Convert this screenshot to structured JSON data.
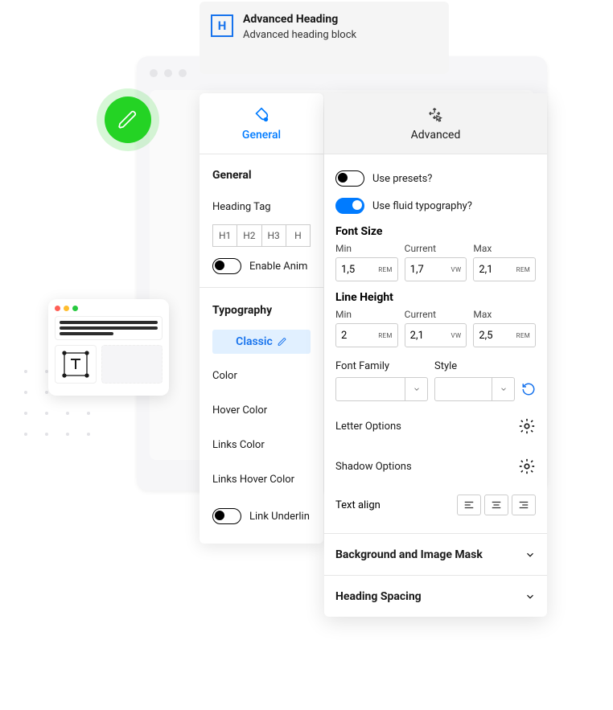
{
  "header": {
    "icon_letter": "H",
    "title": "Advanced Heading",
    "subtitle": "Advanced heading block"
  },
  "tabs": {
    "general": "General",
    "advanced": "Advanced"
  },
  "general": {
    "section": "General",
    "heading_tag_label": "Heading Tag",
    "tags": [
      "H1",
      "H2",
      "H3",
      "H"
    ],
    "enable_anim": "Enable Anim",
    "typography_section": "Typography",
    "classic": "Classic",
    "color": "Color",
    "hover_color": "Hover Color",
    "links_color": "Links Color",
    "links_hover_color": "Links Hover Color",
    "link_underline": "Link Underlin"
  },
  "advanced": {
    "use_presets": "Use presets?",
    "use_fluid": "Use fluid typography?",
    "font_size_title": "Font Size",
    "line_height_title": "Line Height",
    "min": "Min",
    "current": "Current",
    "max": "Max",
    "fs_min": "1,5",
    "fs_current": "1,7",
    "fs_max": "2,1",
    "lh_min": "2",
    "lh_current": "2,1",
    "lh_max": "2,5",
    "unit_rem": "REM",
    "unit_vw": "VW",
    "font_family": "Font Family",
    "style": "Style",
    "letter_options": "Letter Options",
    "shadow_options": "Shadow Options",
    "text_align": "Text align",
    "bg_mask": "Background and Image Mask",
    "heading_spacing": "Heading Spacing"
  }
}
